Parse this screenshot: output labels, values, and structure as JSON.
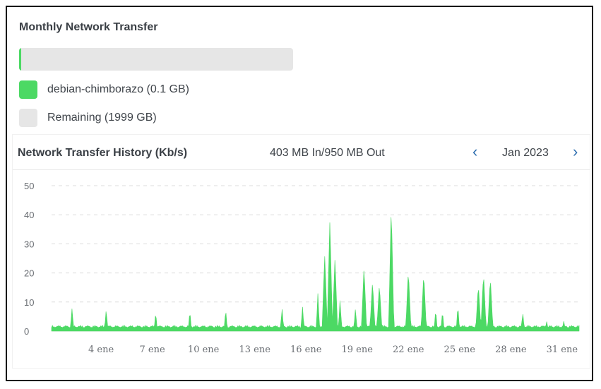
{
  "panel": {
    "title": "Monthly Network Transfer",
    "usage_fraction": 5e-05,
    "legend": [
      {
        "label": "debian-chimborazo (0.1 GB)",
        "color": "#4cd964"
      },
      {
        "label": "Remaining (1999 GB)",
        "color": "#e6e6e6"
      }
    ]
  },
  "history": {
    "title": "Network Transfer History (Kb/s)",
    "summary": "403 MB In/950 MB Out",
    "prev_icon": "chevron-left-icon",
    "next_icon": "chevron-right-icon",
    "prev_glyph": "‹",
    "next_glyph": "›",
    "month": "Jan 2023"
  },
  "chart_data": {
    "type": "area",
    "xlabel": "",
    "ylabel": "",
    "ylim": [
      0,
      50
    ],
    "yticks": [
      "0",
      "10",
      "20",
      "30",
      "40",
      "50"
    ],
    "grid": true,
    "color": "#4cd964",
    "x_tick_labels": [
      {
        "day": 4,
        "label": "4 ene"
      },
      {
        "day": 7,
        "label": "7 ene"
      },
      {
        "day": 10,
        "label": "10 ene"
      },
      {
        "day": 13,
        "label": "13 ene"
      },
      {
        "day": 16,
        "label": "16 ene"
      },
      {
        "day": 19,
        "label": "19 ene"
      },
      {
        "day": 22,
        "label": "22 ene"
      },
      {
        "day": 25,
        "label": "25 ene"
      },
      {
        "day": 28,
        "label": "28 ene"
      },
      {
        "day": 31,
        "label": "31 ene"
      }
    ],
    "x_range": [
      1.1,
      32
    ],
    "baseline": 1.2,
    "peaks": [
      {
        "day": 2.3,
        "value": 8
      },
      {
        "day": 4.3,
        "value": 7.5
      },
      {
        "day": 7.2,
        "value": 6.5
      },
      {
        "day": 9.2,
        "value": 7
      },
      {
        "day": 11.3,
        "value": 7.5
      },
      {
        "day": 14.6,
        "value": 8
      },
      {
        "day": 15.8,
        "value": 8.5
      },
      {
        "day": 16.7,
        "value": 13
      },
      {
        "day": 17.1,
        "value": 26
      },
      {
        "day": 17.4,
        "value": 38
      },
      {
        "day": 17.7,
        "value": 25
      },
      {
        "day": 18.0,
        "value": 11
      },
      {
        "day": 18.9,
        "value": 8
      },
      {
        "day": 19.4,
        "value": 22
      },
      {
        "day": 19.9,
        "value": 17
      },
      {
        "day": 20.3,
        "value": 16
      },
      {
        "day": 21.0,
        "value": 43
      },
      {
        "day": 22.0,
        "value": 21
      },
      {
        "day": 22.9,
        "value": 20
      },
      {
        "day": 23.6,
        "value": 7.5
      },
      {
        "day": 24.0,
        "value": 7
      },
      {
        "day": 24.9,
        "value": 9
      },
      {
        "day": 26.1,
        "value": 16
      },
      {
        "day": 26.4,
        "value": 20
      },
      {
        "day": 26.8,
        "value": 18.5
      },
      {
        "day": 28.7,
        "value": 6.5
      },
      {
        "day": 30.1,
        "value": 3.5
      },
      {
        "day": 31.1,
        "value": 3.5
      }
    ]
  }
}
